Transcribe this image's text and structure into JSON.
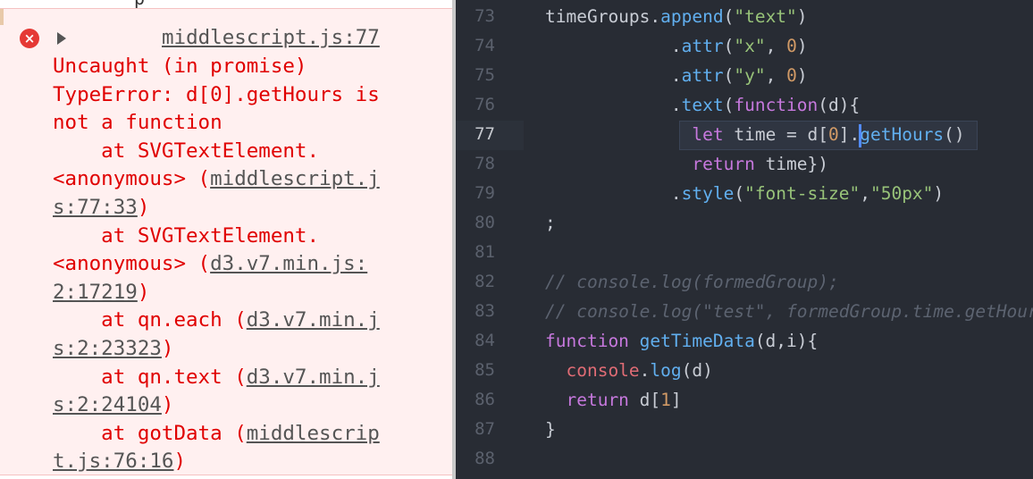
{
  "console": {
    "source_top": "middlescript.js:77",
    "lines": [
      [
        {
          "t": "Uncaught (in promise)"
        }
      ],
      [
        {
          "t": "TypeError: d[0].getHours is"
        }
      ],
      [
        {
          "t": "not a function"
        }
      ],
      [
        {
          "t": "    at SVGTextElement."
        }
      ],
      [
        {
          "t": "<anonymous> ("
        },
        {
          "t": "middlescript.j",
          "u": true
        }
      ],
      [
        {
          "t": "s:77:33",
          "u": true
        },
        {
          "t": ")"
        }
      ],
      [
        {
          "t": "    at SVGTextElement."
        }
      ],
      [
        {
          "t": "<anonymous> ("
        },
        {
          "t": "d3.v7.min.js:",
          "u": true
        }
      ],
      [
        {
          "t": "2:17219",
          "u": true
        },
        {
          "t": ")"
        }
      ],
      [
        {
          "t": "    at qn.each ("
        },
        {
          "t": "d3.v7.min.j",
          "u": true
        }
      ],
      [
        {
          "t": "s:2:23323",
          "u": true
        },
        {
          "t": ")"
        }
      ],
      [
        {
          "t": "    at qn.text ("
        },
        {
          "t": "d3.v7.min.j",
          "u": true
        }
      ],
      [
        {
          "t": "s:2:24104",
          "u": true
        },
        {
          "t": ")"
        }
      ],
      [
        {
          "t": "    at gotData ("
        },
        {
          "t": "middlescrip",
          "u": true
        }
      ],
      [
        {
          "t": "t.js:76:16",
          "u": true
        },
        {
          "t": ")"
        }
      ]
    ]
  },
  "editor": {
    "active_line": "77",
    "line_numbers": [
      "73",
      "74",
      "75",
      "76",
      "77",
      "78",
      "79",
      "80",
      "81",
      "82",
      "83",
      "84",
      "85",
      "86",
      "87",
      "88"
    ],
    "code": [
      [
        {
          "t": "timeGroups.",
          "c": "pl"
        },
        {
          "t": "append",
          "c": "fn"
        },
        {
          "t": "(",
          "c": "pl"
        },
        {
          "t": "\"text\"",
          "c": "str"
        },
        {
          "t": ")",
          "c": "pl"
        }
      ],
      [
        {
          "t": "            .",
          "c": "pl"
        },
        {
          "t": "attr",
          "c": "fn"
        },
        {
          "t": "(",
          "c": "pl"
        },
        {
          "t": "\"x\"",
          "c": "str"
        },
        {
          "t": ", ",
          "c": "pl"
        },
        {
          "t": "0",
          "c": "num"
        },
        {
          "t": ")",
          "c": "pl"
        }
      ],
      [
        {
          "t": "            .",
          "c": "pl"
        },
        {
          "t": "attr",
          "c": "fn"
        },
        {
          "t": "(",
          "c": "pl"
        },
        {
          "t": "\"y\"",
          "c": "str"
        },
        {
          "t": ", ",
          "c": "pl"
        },
        {
          "t": "0",
          "c": "num"
        },
        {
          "t": ")",
          "c": "pl"
        }
      ],
      [
        {
          "t": "            .",
          "c": "pl"
        },
        {
          "t": "text",
          "c": "fn"
        },
        {
          "t": "(",
          "c": "pl"
        },
        {
          "t": "function",
          "c": "kw"
        },
        {
          "t": "(d){",
          "c": "pl"
        }
      ],
      [
        {
          "t": "              ",
          "c": "pl"
        },
        {
          "t": "let",
          "c": "kw"
        },
        {
          "t": " time = d[",
          "c": "pl"
        },
        {
          "t": "0",
          "c": "num"
        },
        {
          "t": "].",
          "c": "pl"
        },
        {
          "t": "getHours",
          "c": "fn"
        },
        {
          "t": "()",
          "c": "pl"
        }
      ],
      [
        {
          "t": "              ",
          "c": "pl"
        },
        {
          "t": "return",
          "c": "kw"
        },
        {
          "t": " time})",
          "c": "pl"
        }
      ],
      [
        {
          "t": "            .",
          "c": "pl"
        },
        {
          "t": "style",
          "c": "fn"
        },
        {
          "t": "(",
          "c": "pl"
        },
        {
          "t": "\"font-size\"",
          "c": "str"
        },
        {
          "t": ",",
          "c": "pl"
        },
        {
          "t": "\"50px\"",
          "c": "str"
        },
        {
          "t": ")",
          "c": "pl"
        }
      ],
      [
        {
          "t": ";",
          "c": "pl"
        }
      ],
      [],
      [
        {
          "t": "// console.log(formedGroup);",
          "c": "cm"
        }
      ],
      [
        {
          "t": "// console.log(\"test\", formedGroup.time.getHours());",
          "c": "cm"
        }
      ],
      [
        {
          "t": "function",
          "c": "kw"
        },
        {
          "t": " ",
          "c": "pl"
        },
        {
          "t": "getTimeData",
          "c": "fn"
        },
        {
          "t": "(d,i){",
          "c": "pl"
        }
      ],
      [
        {
          "t": "  ",
          "c": "pl"
        },
        {
          "t": "console",
          "c": "var"
        },
        {
          "t": ".",
          "c": "pl"
        },
        {
          "t": "log",
          "c": "fn"
        },
        {
          "t": "(d)",
          "c": "pl"
        }
      ],
      [
        {
          "t": "  ",
          "c": "pl"
        },
        {
          "t": "return",
          "c": "kw"
        },
        {
          "t": " d[",
          "c": "pl"
        },
        {
          "t": "1",
          "c": "num"
        },
        {
          "t": "]",
          "c": "pl"
        }
      ],
      [
        {
          "t": "}",
          "c": "pl"
        }
      ],
      []
    ]
  },
  "colors": {
    "error_text": "#e00000",
    "error_bg": "#fff0f0",
    "editor_bg": "#282c34",
    "function": "#61afef",
    "string": "#98c379",
    "number": "#d19a66",
    "keyword": "#c678dd",
    "comment": "#5c6370"
  }
}
